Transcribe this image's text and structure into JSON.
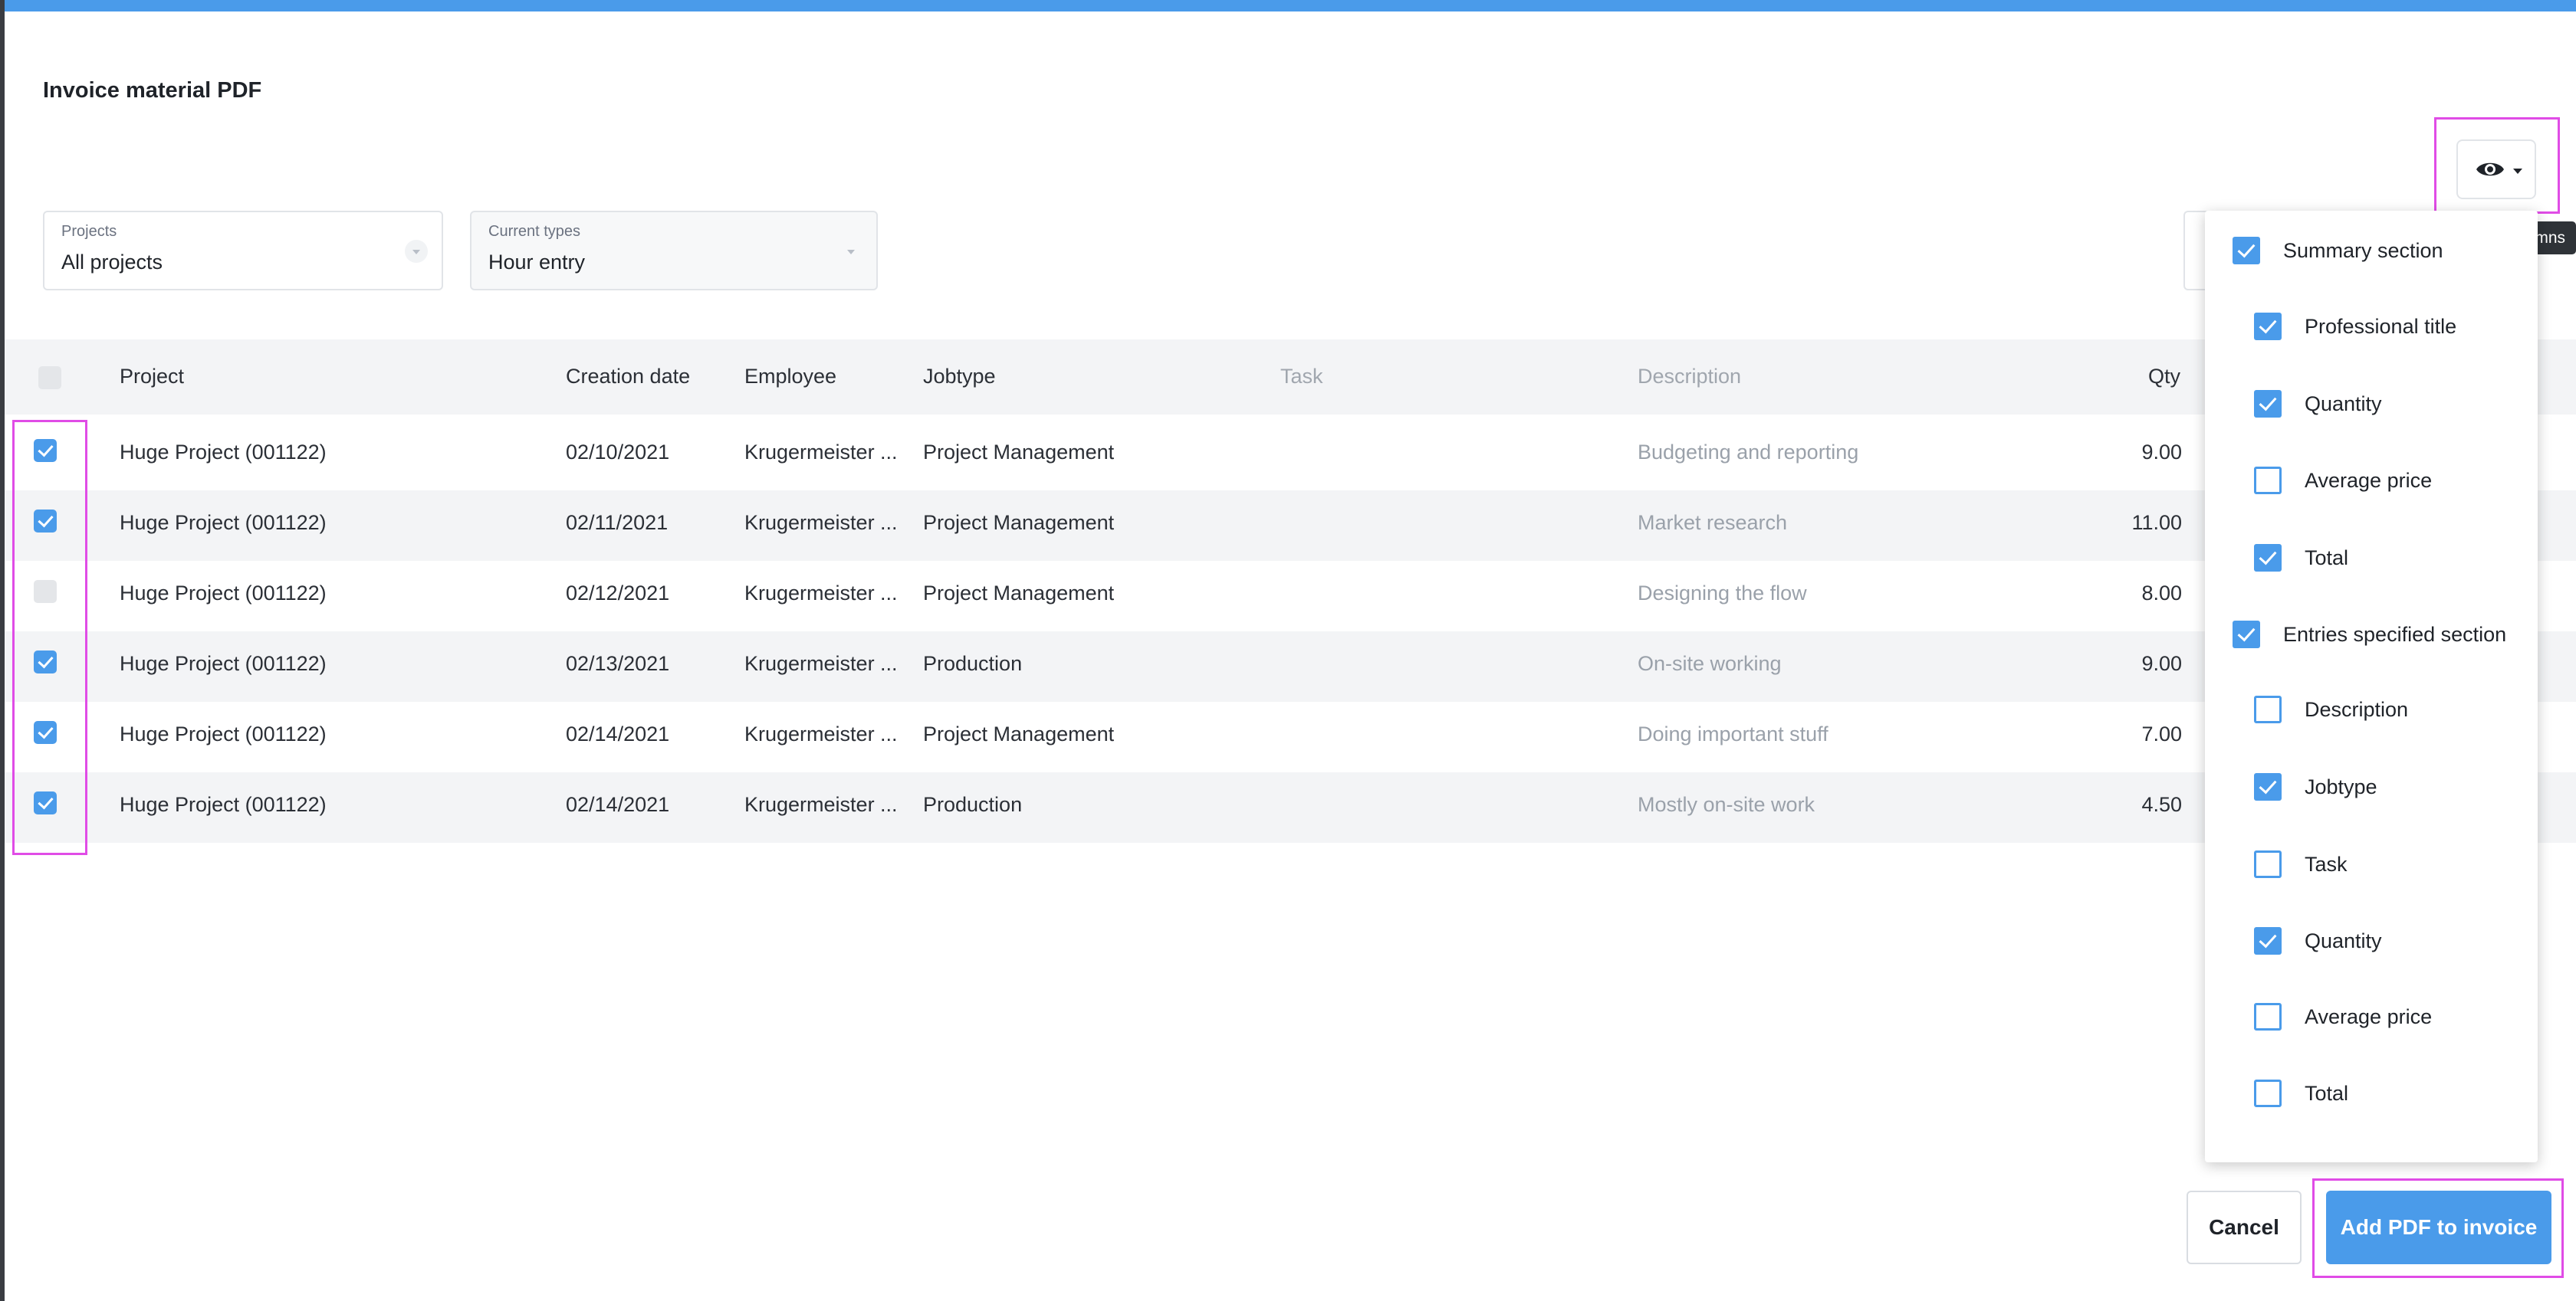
{
  "dialog": {
    "title": "Invoice material PDF"
  },
  "filters": {
    "projects": {
      "label": "Projects",
      "value": "All projects"
    },
    "types": {
      "label": "Current types",
      "value": "Hour entry"
    }
  },
  "toolbar": {
    "tooltip": "Show/hide columns",
    "icon": "eye-icon"
  },
  "table": {
    "headers": [
      "Project",
      "Creation date",
      "Employee",
      "Jobtype",
      "Task",
      "Description",
      "Qty"
    ],
    "rows": [
      {
        "checked": true,
        "project": "Huge Project (001122)",
        "date": "02/10/2021",
        "employee": "Krugermeister ...",
        "jobtype": "Project Management",
        "task": "",
        "description": "Budgeting and reporting",
        "qty": "9.00"
      },
      {
        "checked": true,
        "project": "Huge Project (001122)",
        "date": "02/11/2021",
        "employee": "Krugermeister ...",
        "jobtype": "Project Management",
        "task": "",
        "description": "Market research",
        "qty": "11.00"
      },
      {
        "checked": false,
        "project": "Huge Project (001122)",
        "date": "02/12/2021",
        "employee": "Krugermeister ...",
        "jobtype": "Project Management",
        "task": "",
        "description": "Designing the flow",
        "qty": "8.00"
      },
      {
        "checked": true,
        "project": "Huge Project (001122)",
        "date": "02/13/2021",
        "employee": "Krugermeister ...",
        "jobtype": "Production",
        "task": "",
        "description": "On-site working",
        "qty": "9.00"
      },
      {
        "checked": true,
        "project": "Huge Project (001122)",
        "date": "02/14/2021",
        "employee": "Krugermeister ...",
        "jobtype": "Project Management",
        "task": "",
        "description": "Doing important stuff",
        "qty": "7.00"
      },
      {
        "checked": true,
        "project": "Huge Project (001122)",
        "date": "02/14/2021",
        "employee": "Krugermeister ...",
        "jobtype": "Production",
        "task": "",
        "description": "Mostly on-site work",
        "qty": "4.50"
      }
    ]
  },
  "column_menu": {
    "items": [
      {
        "label": "Summary section",
        "checked": true
      },
      {
        "label": "Professional title",
        "checked": true
      },
      {
        "label": "Quantity",
        "checked": true
      },
      {
        "label": "Average price",
        "checked": false
      },
      {
        "label": "Total",
        "checked": true
      },
      {
        "label": "Entries specified section",
        "checked": true
      },
      {
        "label": "Description",
        "checked": false
      },
      {
        "label": "Jobtype",
        "checked": true
      },
      {
        "label": "Task",
        "checked": false
      },
      {
        "label": "Quantity",
        "checked": true
      },
      {
        "label": "Average price",
        "checked": false
      },
      {
        "label": "Total",
        "checked": false
      }
    ]
  },
  "footer": {
    "cancel_label": "Cancel",
    "add_label": "Add PDF to invoice"
  },
  "colors": {
    "accent": "#4a9bea",
    "highlight": "#e04ce6",
    "tooltip_bg": "#2f3338"
  }
}
